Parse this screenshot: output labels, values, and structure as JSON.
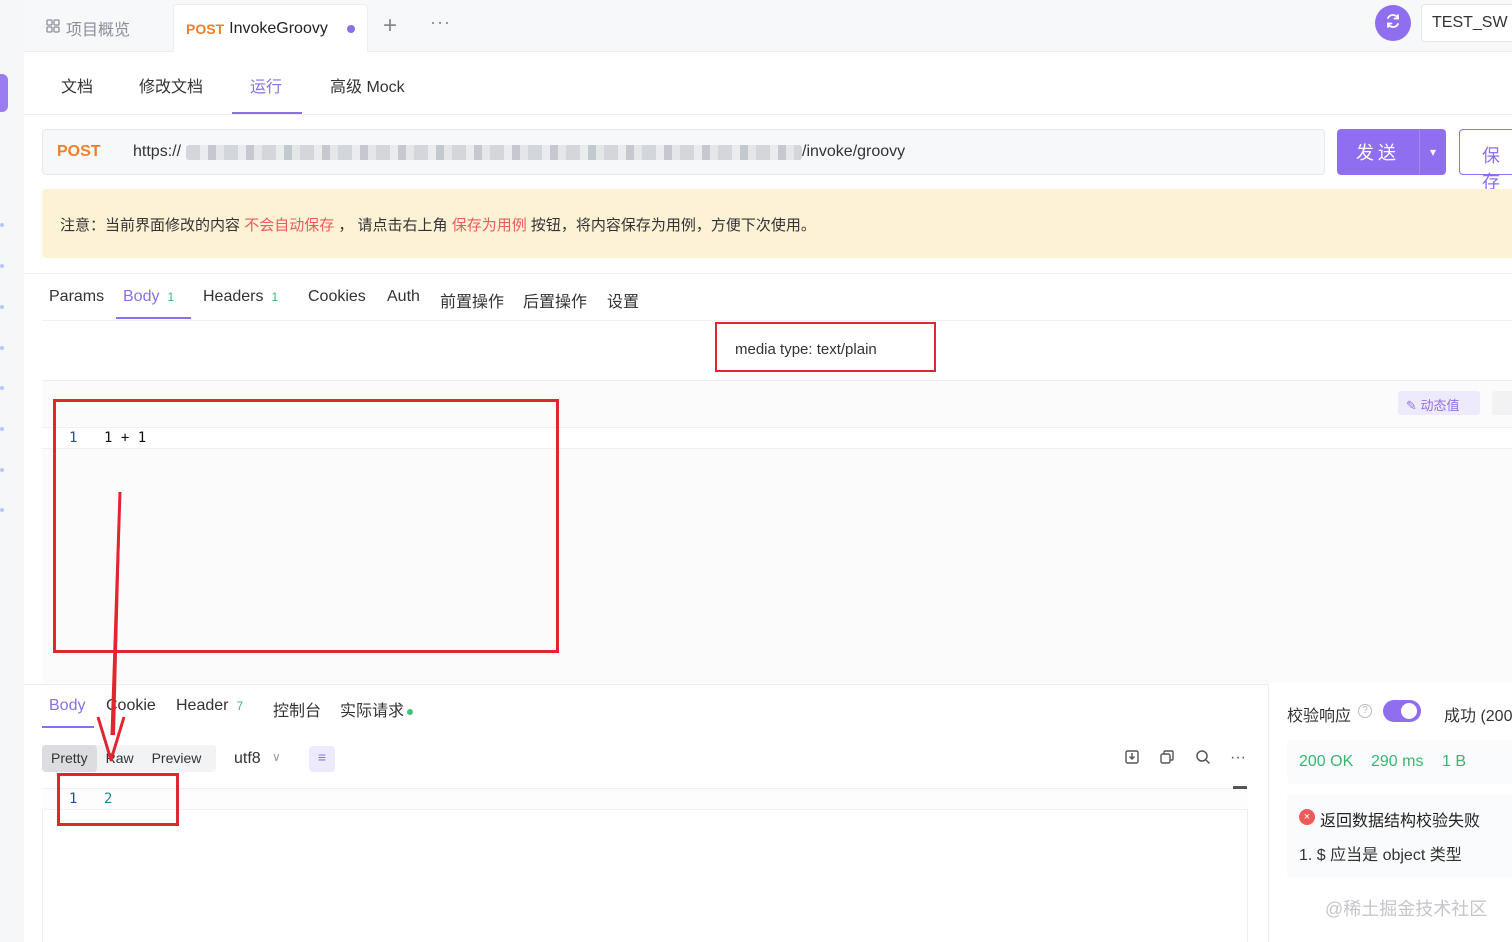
{
  "topbar": {
    "overview_label": "项目概览",
    "active_tab": {
      "method": "POST",
      "name": "InvokeGroovy"
    },
    "add_tab": "+",
    "more": "···",
    "env_name": "TEST_SW"
  },
  "subtabs": [
    "文档",
    "修改文档",
    "运行",
    "高级 Mock"
  ],
  "request": {
    "method": "POST",
    "url_prefix": "https://",
    "url_suffix": "/invoke/groovy",
    "send_label": "发送",
    "save_label": "保存"
  },
  "notice": {
    "prefix": "注意：当前界面修改的内容",
    "highlight1": "不会自动保存",
    "middle": "，  请点击右上角",
    "highlight2": "保存为用例",
    "suffix": "按钮，将内容保存为用例，方便下次使用。"
  },
  "request_tabs": [
    {
      "label": "Params",
      "count": ""
    },
    {
      "label": "Body",
      "count": "1"
    },
    {
      "label": "Headers",
      "count": "1"
    },
    {
      "label": "Cookies",
      "count": ""
    },
    {
      "label": "Auth",
      "count": ""
    },
    {
      "label": "前置操作",
      "count": ""
    },
    {
      "label": "后置操作",
      "count": ""
    },
    {
      "label": "设置",
      "count": ""
    }
  ],
  "media_type": "media type: text/plain",
  "dynamic_value_label": "动态值",
  "request_body": {
    "line_number": "1",
    "code": "1 + 1"
  },
  "response_tabs": [
    {
      "label": "Body",
      "count": ""
    },
    {
      "label": "Cookie",
      "count": ""
    },
    {
      "label": "Header",
      "count": "7"
    },
    {
      "label": "控制台",
      "count": ""
    },
    {
      "label": "实际请求",
      "count": ""
    }
  ],
  "response_view": {
    "modes": [
      "Pretty",
      "Raw",
      "Preview"
    ],
    "selected_mode": "Pretty",
    "encoding": "utf8"
  },
  "response_body": {
    "line_number": "1",
    "code": "2"
  },
  "side_panel": {
    "validate_label": "校验响应",
    "success_label": "成功 (200",
    "status": "200 OK",
    "time": "290 ms",
    "size": "1 B",
    "error_title": "返回数据结构校验失败",
    "error_detail": "1. $ 应当是 object 类型"
  },
  "watermark": "@稀土掘金技术社区",
  "colors": {
    "accent": "#8f6ff0",
    "method": "#f07f2a",
    "annotation": "#e0262e",
    "success": "#3cb371"
  }
}
